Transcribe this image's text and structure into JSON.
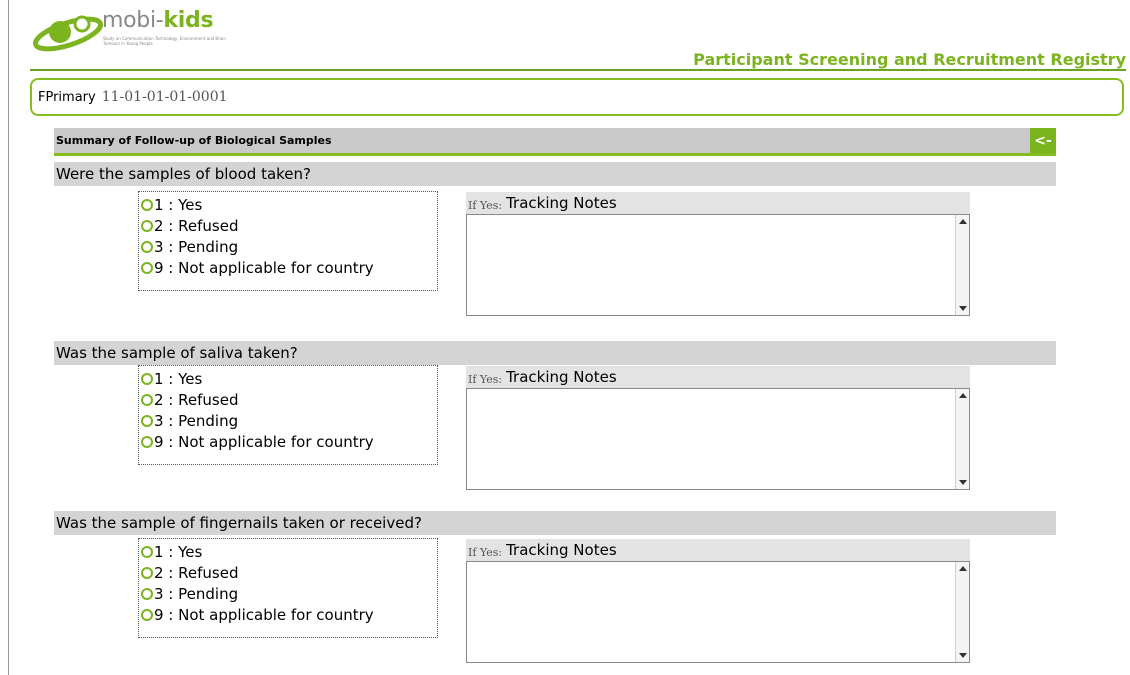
{
  "app": {
    "brand": "mobi-",
    "brand_accent": "kids",
    "brand_tagline": "Study on Communication Technology, Environment and Brain Tumours in Young People",
    "registry_title": "Participant Screening and Recruitment Registry"
  },
  "participant": {
    "label": "FPrimary",
    "id": "11-01-01-01-0001"
  },
  "section": {
    "title": "Summary of Follow-up of Biological Samples",
    "collapse_label": "<-"
  },
  "questions": [
    {
      "question": "Were the samples of blood taken?",
      "options": [
        "1 : Yes",
        "2 : Refused",
        "3 : Pending",
        "9 : Not applicable for country"
      ],
      "notes_prefix": "If Yes:",
      "notes_label": "Tracking Notes",
      "notes_value": ""
    },
    {
      "question": "Was the sample of saliva taken?",
      "options": [
        "1 : Yes",
        "2 : Refused",
        "3 : Pending",
        "9 : Not applicable for country"
      ],
      "notes_prefix": "If Yes:",
      "notes_label": "Tracking Notes",
      "notes_value": ""
    },
    {
      "question": "Was the sample of fingernails taken or received?",
      "options": [
        "1 : Yes",
        "2 : Refused",
        "3 : Pending",
        "9 : Not applicable for country"
      ],
      "notes_prefix": "If Yes:",
      "notes_label": "Tracking Notes",
      "notes_value": ""
    }
  ],
  "colors": {
    "accent_green": "#7cb420",
    "bar_gray": "#d4d4d4"
  }
}
